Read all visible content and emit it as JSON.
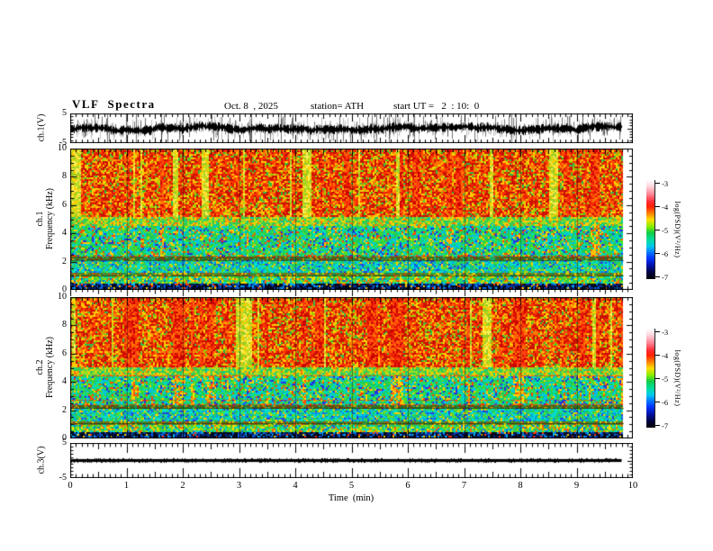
{
  "title": {
    "main": "VLF  Spectra",
    "date": "Oct. 8  , 2025",
    "station": "station= ATH",
    "start": "start UT =   2  : 10:  0"
  },
  "xaxis": {
    "label": "Time  (min)",
    "ticks": [
      "0",
      "1",
      "2",
      "3",
      "4",
      "5",
      "6",
      "7",
      "8",
      "9",
      "10"
    ],
    "range_min": [
      0,
      10
    ]
  },
  "panels": [
    {
      "id": "ch1-waveform",
      "ylabel": "ch.1(V)",
      "yticks": [
        "5",
        "-5"
      ],
      "ylim": [
        -5,
        5
      ]
    },
    {
      "id": "ch1-spectrogram",
      "ylabel_line1": "ch.1",
      "ylabel_line2": "Frequency (kHz)",
      "yticks": [
        "10",
        "8",
        "6",
        "4",
        "2",
        "0"
      ],
      "ylim": [
        0,
        10
      ]
    },
    {
      "id": "ch2-spectrogram",
      "ylabel_line1": "ch.2",
      "ylabel_line2": "Frequency (kHz)",
      "yticks": [
        "10",
        "8",
        "6",
        "4",
        "2",
        "0"
      ],
      "ylim": [
        0,
        10
      ]
    },
    {
      "id": "ch3-waveform",
      "ylabel": "ch.3(V)",
      "yticks": [
        "5",
        "-5"
      ],
      "ylim": [
        -5,
        5
      ]
    }
  ],
  "colorbar": {
    "label": "log(PSD)(V²/Hz)",
    "ticks": [
      "-3",
      "-4",
      "-5",
      "-6",
      "-7"
    ],
    "zlim": [
      -7,
      -3
    ],
    "gradient": [
      [
        0.0,
        "#ffffff"
      ],
      [
        0.06,
        "#ffd9e0"
      ],
      [
        0.14,
        "#ff8899"
      ],
      [
        0.22,
        "#ff2a33"
      ],
      [
        0.27,
        "#ff2200"
      ],
      [
        0.33,
        "#ff7700"
      ],
      [
        0.4,
        "#ffdd00"
      ],
      [
        0.47,
        "#88ee00"
      ],
      [
        0.53,
        "#11cc44"
      ],
      [
        0.6,
        "#00dd99"
      ],
      [
        0.67,
        "#00c8ee"
      ],
      [
        0.73,
        "#0077ff"
      ],
      [
        0.79,
        "#0033ff"
      ],
      [
        0.86,
        "#0011aa"
      ],
      [
        0.93,
        "#000344"
      ],
      [
        1.0,
        "#000000"
      ]
    ]
  },
  "chart_data": [
    {
      "type": "line",
      "name": "ch1-waveform",
      "title": "ch.1 raw voltage",
      "xlabel": "Time (min)",
      "xlim": [
        0,
        10
      ],
      "data_xmax_min": 9.8,
      "ylabel": "ch.1(V)",
      "ylim": [
        -5,
        5
      ],
      "description": "Continuous broadband noise, mean ≈ 0 V, dense core ≈ ±1.5 V, frequent impulsive spikes reaching the ±5 V panel limits for the full 0–9.8 min record",
      "seed": 11
    },
    {
      "type": "heatmap",
      "name": "ch1-spectrogram",
      "title": "ch.1 VLF spectrogram",
      "xlabel": "Time (min)",
      "xlim": [
        0,
        10
      ],
      "data_xmax_min": 9.8,
      "ylabel": "Frequency (kHz)",
      "ylim": [
        0,
        10
      ],
      "zlabel": "log(PSD)(V²/Hz)",
      "zlim": [
        -7,
        -3
      ],
      "minute_gap_lines_min": [
        1,
        2,
        3,
        4,
        5,
        6,
        7,
        8,
        9
      ],
      "red_lines_khz": [
        2.45
      ],
      "dark_lines_khz": [
        2.1,
        1.05
      ],
      "seed": 23,
      "bands": [
        {
          "f": [
            5.2,
            10.01
          ],
          "psd_level": "≈ -3.5, strong impulsive red/orange vertical streaks",
          "mod": "streak",
          "palette": [
            [
              "#cc1100",
              30
            ],
            [
              "#ff3300",
              22
            ],
            [
              "#ff7700",
              18
            ],
            [
              "#ffcc00",
              16
            ],
            [
              "#99cc00",
              8
            ],
            [
              "#33bb44",
              6
            ]
          ]
        },
        {
          "f": [
            4.5,
            5.2
          ],
          "psd_level": "≈ -4.5 transition",
          "mod": "none",
          "palette": [
            [
              "#ffcc00",
              22
            ],
            [
              "#99dd22",
              28
            ],
            [
              "#33cc55",
              34
            ],
            [
              "#ff7700",
              10
            ],
            [
              "#00ccaa",
              6
            ]
          ]
        },
        {
          "f": [
            2.3,
            4.5
          ],
          "psd_level": "≈ -5, green/cyan with blue minima and sparse red impulses",
          "mod": "midstreak",
          "palette": [
            [
              "#22cc55",
              26
            ],
            [
              "#00ddaa",
              22
            ],
            [
              "#55dd22",
              14
            ],
            [
              "#00bbee",
              14
            ],
            [
              "#2233dd",
              9
            ],
            [
              "#ffcc00",
              9
            ],
            [
              "#ff4400",
              6
            ]
          ]
        },
        {
          "f": [
            2.05,
            2.3
          ],
          "psd_level": "≈ -6 dark band",
          "mod": "none",
          "palette": [
            [
              "#556611",
              34
            ],
            [
              "#227733",
              26
            ],
            [
              "#883311",
              16
            ],
            [
              "#cc9900",
              12
            ],
            [
              "#22aa66",
              12
            ]
          ]
        },
        {
          "f": [
            1.2,
            2.05
          ],
          "psd_level": "≈ -5.2 cyan band",
          "mod": "none",
          "palette": [
            [
              "#00ddcc",
              28
            ],
            [
              "#22cc66",
              26
            ],
            [
              "#0099ee",
              16
            ],
            [
              "#2244dd",
              10
            ],
            [
              "#66dd22",
              12
            ],
            [
              "#ffcc00",
              8
            ]
          ]
        },
        {
          "f": [
            0.95,
            1.2
          ],
          "psd_level": "≈ -6 dark band",
          "mod": "none",
          "palette": [
            [
              "#667711",
              30
            ],
            [
              "#339944",
              22
            ],
            [
              "#aa5511",
              18
            ],
            [
              "#ddcc00",
              16
            ],
            [
              "#118855",
              14
            ]
          ]
        },
        {
          "f": [
            0.5,
            0.95
          ],
          "psd_level": "≈ -5 green/yellow band",
          "mod": "none",
          "palette": [
            [
              "#33cc44",
              26
            ],
            [
              "#00ddbb",
              20
            ],
            [
              "#99dd00",
              20
            ],
            [
              "#ffdd00",
              14
            ],
            [
              "#0077dd",
              10
            ],
            [
              "#ff6600",
              10
            ]
          ]
        },
        {
          "f": [
            0.12,
            0.5
          ],
          "psd_level": "≈ -6.8 near noise floor",
          "mod": "none",
          "palette": [
            [
              "#000822",
              40
            ],
            [
              "#0033aa",
              18
            ],
            [
              "#0066dd",
              14
            ],
            [
              "#002255",
              12
            ],
            [
              "#00aaee",
              8
            ],
            [
              "#ff3300",
              4
            ],
            [
              "#ffcc00",
              4
            ]
          ]
        },
        {
          "f": [
            0,
            0.12
          ],
          "psd_level": "floor with mixed specks",
          "mod": "none",
          "palette": [
            [
              "#000000",
              46
            ],
            [
              "#0044cc",
              18
            ],
            [
              "#ff3300",
              14
            ],
            [
              "#ffcc00",
              12
            ],
            [
              "#22cc44",
              10
            ]
          ]
        }
      ]
    },
    {
      "type": "heatmap",
      "name": "ch2-spectrogram",
      "title": "ch.2 VLF spectrogram",
      "xlabel": "Time (min)",
      "xlim": [
        0,
        10
      ],
      "data_xmax_min": 9.8,
      "ylabel": "Frequency (kHz)",
      "ylim": [
        0,
        10
      ],
      "zlabel": "log(PSD)(V²/Hz)",
      "zlim": [
        -7,
        -3
      ],
      "minute_gap_lines_min": [
        1,
        2,
        3,
        4,
        5,
        6,
        7,
        8,
        9
      ],
      "red_lines_khz": [
        4.45,
        2.75,
        2.45
      ],
      "dark_lines_khz": [
        2.15,
        1.1
      ],
      "seed": 37,
      "bands": [
        {
          "f": [
            5.0,
            10.01
          ],
          "psd_level": "≈ -3.5, strong impulsive red/orange vertical streaks",
          "mod": "streak",
          "palette": [
            [
              "#cc1100",
              30
            ],
            [
              "#ff3300",
              22
            ],
            [
              "#ff7700",
              18
            ],
            [
              "#ffcc00",
              16
            ],
            [
              "#99cc00",
              8
            ],
            [
              "#33bb44",
              6
            ]
          ]
        },
        {
          "f": [
            4.4,
            5.0
          ],
          "psd_level": "≈ -4.5 transition",
          "mod": "none",
          "palette": [
            [
              "#ffcc00",
              22
            ],
            [
              "#99dd22",
              28
            ],
            [
              "#33cc55",
              34
            ],
            [
              "#ff7700",
              10
            ],
            [
              "#00ccaa",
              6
            ]
          ]
        },
        {
          "f": [
            2.35,
            4.4
          ],
          "psd_level": "≈ -5, green/cyan with blue minima and sparse red impulses",
          "mod": "midstreak",
          "palette": [
            [
              "#22cc55",
              26
            ],
            [
              "#00ddaa",
              22
            ],
            [
              "#55dd22",
              14
            ],
            [
              "#00bbee",
              14
            ],
            [
              "#2233dd",
              9
            ],
            [
              "#ffcc00",
              9
            ],
            [
              "#ff4400",
              6
            ]
          ]
        },
        {
          "f": [
            2.05,
            2.35
          ],
          "psd_level": "≈ -6 dark band",
          "mod": "none",
          "palette": [
            [
              "#556611",
              34
            ],
            [
              "#227733",
              26
            ],
            [
              "#883311",
              16
            ],
            [
              "#cc9900",
              12
            ],
            [
              "#22aa66",
              12
            ]
          ]
        },
        {
          "f": [
            1.25,
            2.05
          ],
          "psd_level": "≈ -5.2 cyan band",
          "mod": "none",
          "palette": [
            [
              "#00ddcc",
              28
            ],
            [
              "#22cc66",
              26
            ],
            [
              "#0099ee",
              16
            ],
            [
              "#2244dd",
              10
            ],
            [
              "#66dd22",
              12
            ],
            [
              "#ffcc00",
              8
            ]
          ]
        },
        {
          "f": [
            0.95,
            1.25
          ],
          "psd_level": "≈ -6 dark band",
          "mod": "none",
          "palette": [
            [
              "#667711",
              30
            ],
            [
              "#339944",
              22
            ],
            [
              "#aa5511",
              18
            ],
            [
              "#ddcc00",
              16
            ],
            [
              "#118855",
              14
            ]
          ]
        },
        {
          "f": [
            0.5,
            0.95
          ],
          "psd_level": "≈ -5 green/yellow band",
          "mod": "none",
          "palette": [
            [
              "#33cc44",
              26
            ],
            [
              "#00ddbb",
              20
            ],
            [
              "#99dd00",
              20
            ],
            [
              "#ffdd00",
              14
            ],
            [
              "#0077dd",
              10
            ],
            [
              "#ff6600",
              10
            ]
          ]
        },
        {
          "f": [
            0.12,
            0.5
          ],
          "psd_level": "≈ -6.8 near noise floor",
          "mod": "none",
          "palette": [
            [
              "#000822",
              40
            ],
            [
              "#0033aa",
              18
            ],
            [
              "#0066dd",
              14
            ],
            [
              "#002255",
              12
            ],
            [
              "#00aaee",
              8
            ],
            [
              "#ff3300",
              4
            ],
            [
              "#ffcc00",
              4
            ]
          ]
        },
        {
          "f": [
            0,
            0.12
          ],
          "psd_level": "floor with mixed specks",
          "mod": "none",
          "palette": [
            [
              "#000000",
              46
            ],
            [
              "#0044cc",
              18
            ],
            [
              "#ff3300",
              14
            ],
            [
              "#ffcc00",
              12
            ],
            [
              "#22cc44",
              10
            ]
          ]
        }
      ]
    },
    {
      "type": "line",
      "name": "ch3-waveform",
      "title": "ch.3 raw voltage",
      "xlabel": "Time (min)",
      "xlim": [
        0,
        10
      ],
      "data_xmax_min": 9.8,
      "ylabel": "ch.3(V)",
      "ylim": [
        -5,
        5
      ],
      "flat_value": 0,
      "description": "Constant 0 V thick black trace (no signal) from 0 to ≈9.8 min",
      "seed": 5
    }
  ]
}
